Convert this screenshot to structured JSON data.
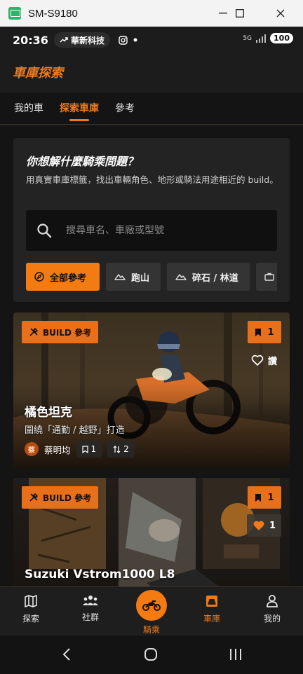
{
  "window": {
    "title": "SM-S9180",
    "controls": [
      "minimize",
      "maximize",
      "close"
    ]
  },
  "status": {
    "time": "20:36",
    "notification_pill": "華新科技",
    "network": "5G",
    "battery": "100"
  },
  "app": {
    "brand": "車庫探索"
  },
  "tabs": [
    {
      "label": "我的車",
      "active": false
    },
    {
      "label": "探索車庫",
      "active": true
    },
    {
      "label": "參考",
      "active": false
    }
  ],
  "search_card": {
    "title": "你想解什麼騎乘問題？",
    "description": "用真實車庫標籤，找出車輛角色、地形或騎法用途相近的 build。",
    "placeholder": "搜尋車名、車廠或型號",
    "chips": [
      {
        "label": "全部參考",
        "icon": "compass-icon",
        "active": true
      },
      {
        "label": "跑山",
        "icon": "mountain-icon",
        "active": false
      },
      {
        "label": "碎石 / 林道",
        "icon": "mountain-icon",
        "active": false
      },
      {
        "label": "",
        "icon": "briefcase-icon",
        "active": false
      }
    ]
  },
  "builds": [
    {
      "badge": "BUILD 參考",
      "saves": "1",
      "like_label": "讚",
      "title": "橘色坦克",
      "subtitle": "圍繞「通勤 / 越野」打造",
      "author_initial": "蔡",
      "author": "蔡明均",
      "bookmark_count": "1",
      "fork_count": "2"
    },
    {
      "badge": "BUILD 參考",
      "saves": "1",
      "like_count": "1",
      "title": "Suzuki Vstrom1000 L8"
    }
  ],
  "bottom_nav": [
    {
      "label": "探索",
      "icon": "map-icon",
      "active": false
    },
    {
      "label": "社群",
      "icon": "people-icon",
      "active": false
    },
    {
      "label": "騎乘",
      "icon": "motorcycle-icon",
      "active": false
    },
    {
      "label": "車庫",
      "icon": "garage-icon",
      "active": true
    },
    {
      "label": "我的",
      "icon": "person-icon",
      "active": false
    }
  ],
  "colors": {
    "accent": "#f07a1a",
    "background": "#141414",
    "card": "#232323"
  }
}
